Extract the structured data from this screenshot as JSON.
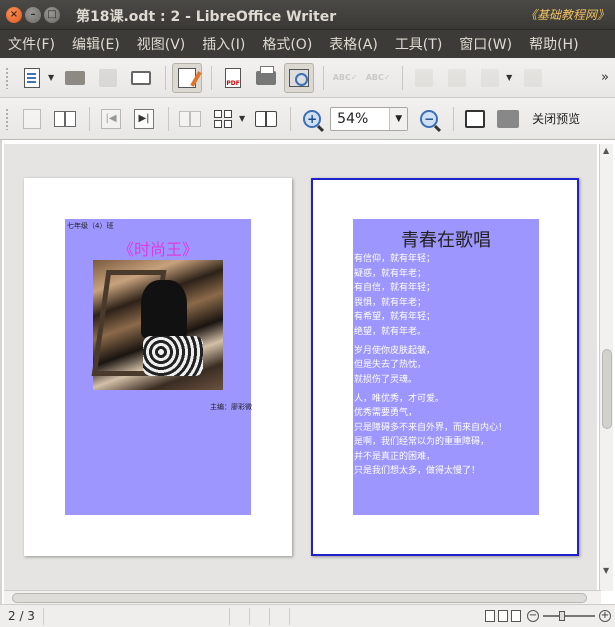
{
  "window": {
    "title": "第18课.odt : 2 - LibreOffice Writer",
    "watermark": "《基础教程网》"
  },
  "menu": [
    "文件(F)",
    "编辑(E)",
    "视图(V)",
    "插入(I)",
    "格式(O)",
    "表格(A)",
    "工具(T)",
    "窗口(W)",
    "帮助(H)"
  ],
  "toolbar": {
    "more_label": "»"
  },
  "preview_toolbar": {
    "zoom_value": "54%",
    "close_label": "关闭预览"
  },
  "page1": {
    "class_label": "七年级（4）班",
    "title": "《时尚王》",
    "author": "主编：廖彩微"
  },
  "page2": {
    "title": "青春在歌唱",
    "stanzas": [
      [
        "有信仰，就有年轻；",
        "疑惑，就有年老；",
        "有自信，就有年轻；",
        "畏惧，就有年老；",
        "有希望，就有年轻；",
        "绝望，就有年老。"
      ],
      [
        "岁月使你皮肤起皱，",
        "但是失去了热忱，",
        "就损伤了灵魂。"
      ],
      [
        "人，唯优秀，才可爱。",
        "优秀需要勇气，",
        "只是障碍多不来自外界，而来自内心！",
        "是啊，我们经常以为的重重障碍，",
        "并不是真正的困难，",
        "只是我们想太多，做得太慢了！"
      ]
    ]
  },
  "statusbar": {
    "page_indicator": "2 / 3"
  }
}
